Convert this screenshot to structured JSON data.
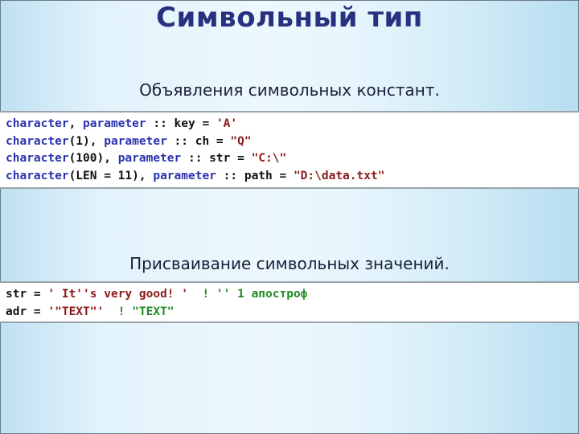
{
  "slide": {
    "title": "Символьный тип",
    "colors": {
      "title": "#27317f",
      "keyword": "#2a32b0",
      "plain": "#111111",
      "string": "#8b1a1a",
      "comment": "#1f8a25"
    }
  },
  "section1": {
    "heading": "Объявления символьных констант.",
    "lines": [
      [
        {
          "t": "kw",
          "v": "character"
        },
        {
          "t": "tx",
          "v": ", "
        },
        {
          "t": "kw",
          "v": "parameter"
        },
        {
          "t": "tx",
          "v": " :: key = "
        },
        {
          "t": "str",
          "v": "'A'"
        }
      ],
      [
        {
          "t": "kw",
          "v": "character"
        },
        {
          "t": "tx",
          "v": "(1), "
        },
        {
          "t": "kw",
          "v": "parameter"
        },
        {
          "t": "tx",
          "v": " :: ch = "
        },
        {
          "t": "str",
          "v": "\"Q\""
        }
      ],
      [
        {
          "t": "kw",
          "v": "character"
        },
        {
          "t": "tx",
          "v": "(100), "
        },
        {
          "t": "kw",
          "v": "parameter"
        },
        {
          "t": "tx",
          "v": " :: str = "
        },
        {
          "t": "str",
          "v": "\"C:\\\""
        }
      ],
      [
        {
          "t": "kw",
          "v": "character"
        },
        {
          "t": "tx",
          "v": "(LEN = 11), "
        },
        {
          "t": "kw",
          "v": "parameter"
        },
        {
          "t": "tx",
          "v": " :: path = "
        },
        {
          "t": "str",
          "v": "\"D:\\data.txt\""
        }
      ]
    ]
  },
  "section2": {
    "heading": "Присваивание символьных значений.",
    "lines": [
      [
        {
          "t": "tx",
          "v": "str = "
        },
        {
          "t": "str",
          "v": "' It''s very good! '"
        },
        {
          "t": "cm",
          "v": "  ! '' 1 апостроф"
        }
      ],
      [
        {
          "t": "tx",
          "v": "adr = "
        },
        {
          "t": "str",
          "v": "'\"TEXT\"'"
        },
        {
          "t": "cm",
          "v": "  ! \"TEXT\""
        }
      ]
    ]
  }
}
